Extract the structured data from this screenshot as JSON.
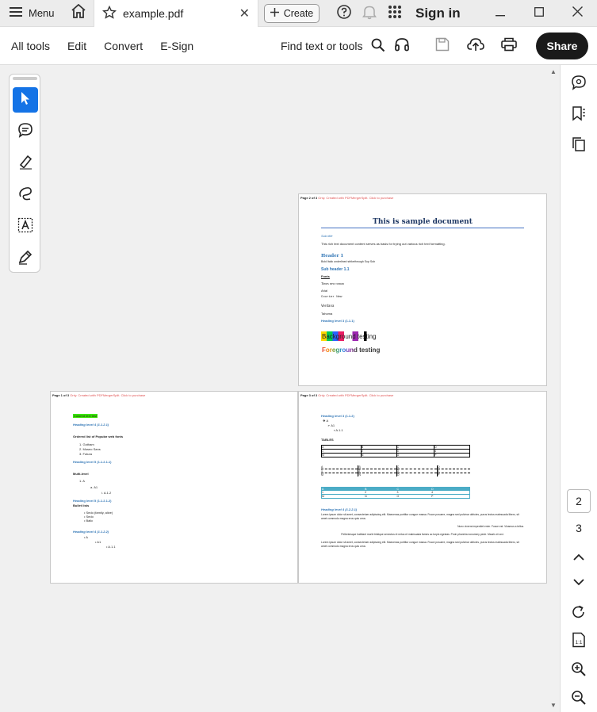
{
  "titlebar": {
    "menu_label": "Menu",
    "tab_title": "example.pdf",
    "create_label": "Create",
    "signin_label": "Sign in"
  },
  "toolbar": {
    "menus": [
      "All tools",
      "Edit",
      "Convert",
      "E-Sign"
    ],
    "find_label": "Find text or tools",
    "share_label": "Share"
  },
  "navigation": {
    "current_page": "2",
    "next_page": "3"
  },
  "pdf": {
    "page_header_watermark": "Only. Created with PDFMergerSplit. Click to purchase",
    "page2": {
      "header_pagenum": "Page 2 of 3",
      "title": "This is sample document",
      "subtitle": "Sub title",
      "intro": "This rich text document content serves as basis for trying out various rich text formatting.",
      "header1": "Header 1",
      "styles_line": "Bold Italic underlined strikethrough Sup Sub",
      "subheader": "Sub header 1.1",
      "fonts_label": "Fonts",
      "font_lines": [
        "Times new roman",
        "Arial",
        "Courier New",
        "Verdana",
        "Tahoma"
      ],
      "heading3": "Heading level 3 (1.1.1)",
      "background_text": "Background testing",
      "foreground_text": "Foreground testing"
    },
    "page3": {
      "header_pagenum": "Page 3 of 3",
      "heading_a": "Heading level 3 (1.1.2)",
      "list_items": [
        "A",
        "A1",
        "A.1.1"
      ],
      "tables_label": "TABLES",
      "table_header": [
        "A",
        "B",
        "C",
        "D"
      ],
      "table_rows": [
        [
          "1",
          "2",
          "3",
          "4"
        ],
        [
          "M",
          "N",
          "O",
          "P"
        ]
      ],
      "heading_b": "Heading level 4 (1.2.2.1)",
      "lorem_1": "Lorem ipsum dolor sit amet, consectetuer adipiscing elit. Maecenas porttitor congue massa. Fusce posuere, magna sed pulvinar ultricies, purus lectus malesuada libero, sit amet commodo magna eros quis urna.",
      "lorem_right": "Nunc viverra imperdiet enim. Fusce est. Vivamus a tellus.",
      "lorem_center": "Pellentesque habitant morbi tristique senectus et netus et malesuada fames ac turpis egestas. Proin pharetra nonummy pede. Mauris et orci.",
      "lorem_2": "Lorem ipsum dolor sit amet, consectetuer adipiscing elit. Maecenas porttitor congue massa. Fusce posuere, magna sed pulvinar ultricies, purus lectus malesuada libero, sit amet commodo magna eros quis urna."
    },
    "page1": {
      "header_pagenum": "Page 1 of 3",
      "highlight_text": "Colored text test",
      "heading4": "Heading level 4 (1.1.2.1)",
      "ordered_title": "Ordered list of Popular web fonts",
      "ordered_items": [
        "Gotham",
        "Museo Sans",
        "Futura"
      ],
      "heading5": "Heading level 5 (1.1.2.1.1)",
      "multilevel_label": "Multi-level",
      "multilevel_items": [
        "A",
        "A1",
        "A.1.2"
      ],
      "heading5b": "Heading level 5 (1.1.2.1.2)",
      "bullet_label": "Bullet lists",
      "bullet_items": [
        "Sedo (family, alive)",
        "Sedo",
        "Balic"
      ],
      "heading4b": "Heading level 4 (1.1.2.2)",
      "bullet2_items": [
        "A",
        "A1",
        "A.1.1"
      ]
    }
  }
}
